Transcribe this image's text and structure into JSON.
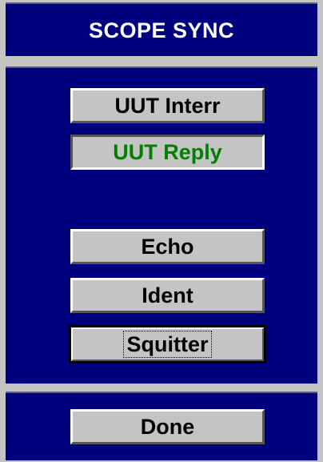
{
  "header": {
    "title": "SCOPE SYNC"
  },
  "main": {
    "uut_interr_label": "UUT Interr",
    "uut_reply_label": "UUT Reply",
    "uut_reply_color": "#008000",
    "echo_label": "Echo",
    "ident_label": "Ident",
    "squitter_label": "Squitter"
  },
  "footer": {
    "done_label": "Done"
  },
  "colors": {
    "panel_bg": "#00007f",
    "window_bg": "#c4c4c4",
    "button_face": "#c4c4c4",
    "title_text": "#ffffff"
  }
}
